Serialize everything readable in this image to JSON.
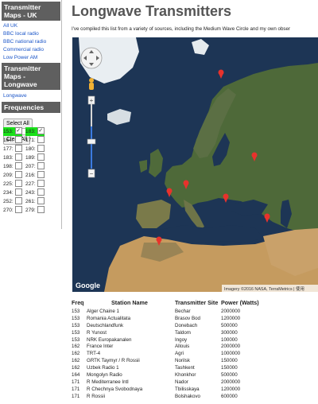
{
  "sidebar": {
    "uk_heading": "Transmitter Maps - UK",
    "uk_links": [
      "All UK",
      "BBC local radio",
      "BBC national radio",
      "Commercial radio",
      "Low Power AM"
    ],
    "lw_heading": "Transmitter Maps - Longwave",
    "lw_links": [
      "Longwave"
    ],
    "freq_heading": "Frequencies",
    "select_all": "Select All",
    "clear_all": "Clear All",
    "frequencies": [
      [
        {
          "label": "153:",
          "checked": true
        },
        {
          "label": "183:",
          "checked": true
        }
      ],
      [
        {
          "label": "164:",
          "checked": false
        },
        {
          "label": "171:",
          "checked": false
        }
      ],
      [
        {
          "label": "177:",
          "checked": false
        },
        {
          "label": "180:",
          "checked": false
        }
      ],
      [
        {
          "label": "183:",
          "checked": false
        },
        {
          "label": "189:",
          "checked": false
        }
      ],
      [
        {
          "label": "198:",
          "checked": false
        },
        {
          "label": "207:",
          "checked": false
        }
      ],
      [
        {
          "label": "209:",
          "checked": false
        },
        {
          "label": "216:",
          "checked": false
        }
      ],
      [
        {
          "label": "225:",
          "checked": false
        },
        {
          "label": "227:",
          "checked": false
        }
      ],
      [
        {
          "label": "234:",
          "checked": false
        },
        {
          "label": "243:",
          "checked": false
        }
      ],
      [
        {
          "label": "252:",
          "checked": false
        },
        {
          "label": "261:",
          "checked": false
        }
      ],
      [
        {
          "label": "270:",
          "checked": false
        },
        {
          "label": "279:",
          "checked": false
        }
      ]
    ]
  },
  "main": {
    "title": "Longwave Transmitters",
    "intro": "I've compiled this list from a variety of sources, including the Medium Wave Circle and my own obser"
  },
  "map": {
    "google_logo": "Google",
    "attribution": "Imagery ©2016 NASA, TerraMetrics | 使用",
    "zoom_in": "+",
    "zoom_out": "−",
    "colors": {
      "sea": "#1d3555",
      "land": "#4f6a3a",
      "desert": "#c49a5d",
      "ice": "#eef2f4",
      "marker": "#e8322c"
    }
  },
  "table": {
    "headers": [
      "Freq",
      "Station Name",
      "Transmitter Site",
      "Power (Watts)"
    ],
    "rows": [
      [
        "153",
        "Alger Chaine 1",
        "Bechar",
        "2000000"
      ],
      [
        "153",
        "Romania Actualitata",
        "Brasov Bod",
        "1200000"
      ],
      [
        "153",
        "Deutschlandfunk",
        "Donebach",
        "500000"
      ],
      [
        "153",
        "R Yunost",
        "Taldom",
        "300000"
      ],
      [
        "153",
        "NRK Europakanalen",
        "Ingoy",
        "100000"
      ],
      [
        "162",
        "France Inter",
        "Allouis",
        "2000000"
      ],
      [
        "162",
        "TRT-4",
        "Agri",
        "1000000"
      ],
      [
        "162",
        "GRTK Taymyr / R Rossii",
        "Norilsk",
        "150000"
      ],
      [
        "162",
        "Uzbek Radio 1",
        "Tashkent",
        "150000"
      ],
      [
        "164",
        "Mongolyn Radio",
        "Khonkhor",
        "500000"
      ],
      [
        "171",
        "R Mediterranee Intl",
        "Nador",
        "2000000"
      ],
      [
        "171",
        "R Chechnya Svobodnaya",
        "Tbilisskaya",
        "1200000"
      ],
      [
        "171",
        "R Rossii",
        "Bolshakovo",
        "600000"
      ]
    ]
  }
}
